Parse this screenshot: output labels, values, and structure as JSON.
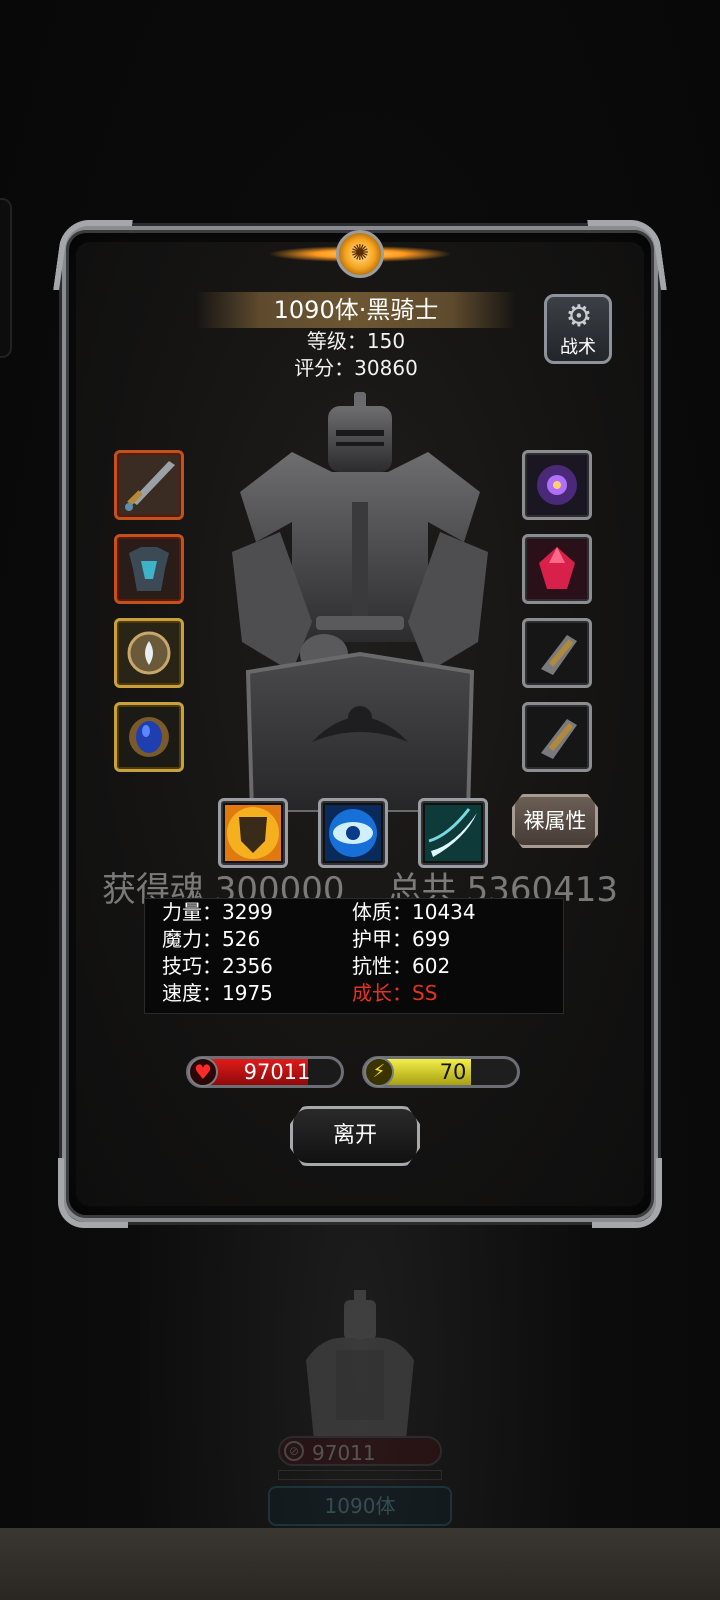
{
  "unit": {
    "title": "1090体·黑骑士",
    "level_text": "等级：150",
    "score_text": "评分：30860"
  },
  "buttons": {
    "tactics_label": "战术",
    "bare_attributes_label": "裸属性",
    "leave_label": "离开"
  },
  "reward_text": "获得魂 300000    总共 5360413",
  "stats": {
    "strength": "力量：3299",
    "constitution": "体质：10434",
    "magic": "魔力：526",
    "armor": "护甲：699",
    "skill": "技巧：2356",
    "resistance": "抗性：602",
    "speed": "速度：1975",
    "growth": "成长：SS"
  },
  "bars": {
    "hp_value": "97011",
    "hp_fill_fraction": 0.78,
    "energy_value": "70",
    "energy_fill_fraction": 0.7
  },
  "equipment": {
    "left": [
      "greatsword-icon",
      "chest-armor-icon",
      "amulet-icon",
      "sapphire-ring-icon"
    ],
    "right": [
      "dark-orb-icon",
      "ruby-gem-icon",
      "gauntlet-icon",
      "gauntlet-icon"
    ]
  },
  "skills": [
    "shield-skill-icon",
    "eye-skill-icon",
    "slash-skill-icon"
  ],
  "background_card": {
    "hp_value": "97011",
    "name": "1090体"
  },
  "colors": {
    "growth_red": "#e8321e",
    "hp_red": "#e11a1a",
    "energy_yellow": "#f2ee4a"
  }
}
